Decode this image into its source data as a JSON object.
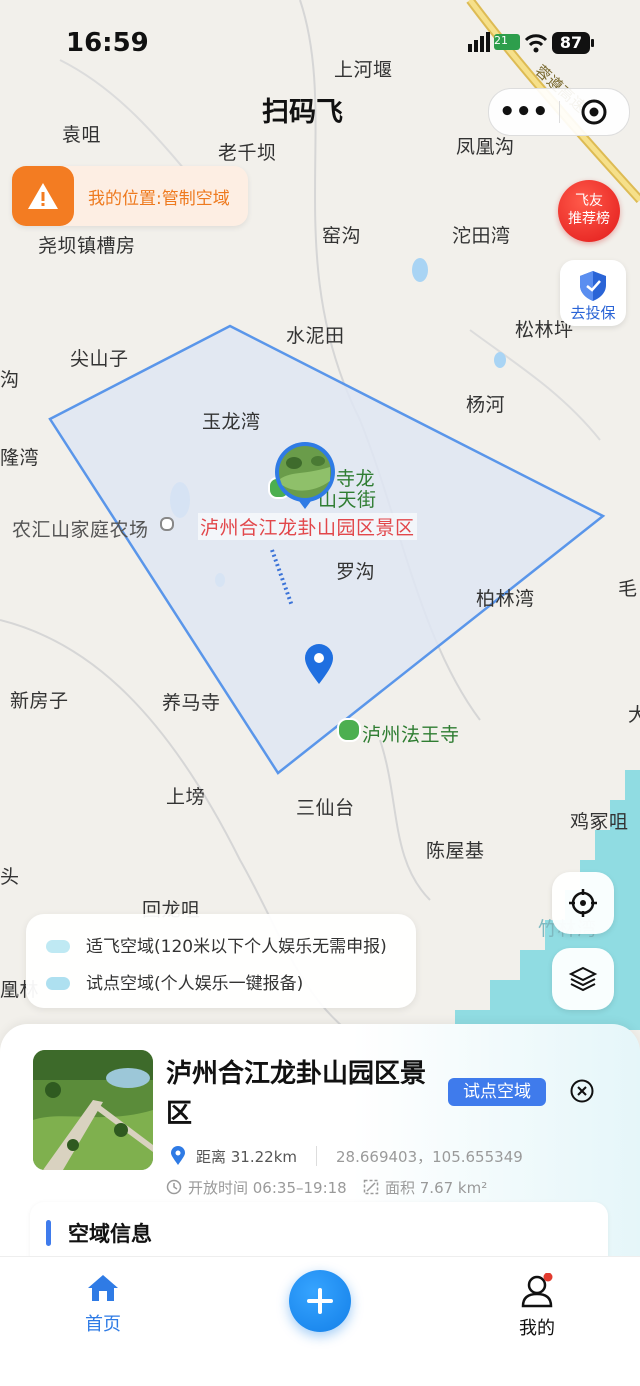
{
  "status_bar": {
    "time": "16:59",
    "battery": "87",
    "signal_tag": "21"
  },
  "header": {
    "title": "扫码飞"
  },
  "warning": {
    "text": "我的位置:管制空域"
  },
  "side_buttons": {
    "rank_line1": "飞友",
    "rank_line2": "推荐榜",
    "insure_label": "去投保"
  },
  "map": {
    "road_label": "蓉遵高速",
    "places": [
      "上河堰",
      "袁咀",
      "老千坝",
      "凤凰沟",
      "尧坝镇槽房",
      "窑沟",
      "沱田湾",
      "水泥田",
      "松林坪",
      "尖山子",
      "杨河",
      "玉龙湾",
      "隆湾",
      "寺龙",
      "山天街",
      "农汇山家庭农场",
      "泸州合江龙卦山园区景区",
      "罗沟",
      "柏林湾",
      "毛",
      "新房子",
      "养马寺",
      "泸州法王寺",
      "大",
      "上塝",
      "三仙台",
      "鸡冢咀",
      "陈屋基",
      "头",
      "回龙咀",
      "竹林湾",
      "凰林",
      "沟"
    ]
  },
  "legend": {
    "items": [
      {
        "label": "适飞空域(120米以下个人娱乐无需申报)",
        "color": "#bfe9f3"
      },
      {
        "label": "试点空域(个人娱乐一键报备)",
        "color": "#aee0f0"
      }
    ]
  },
  "detail": {
    "name": "泸州合江龙卦山园区景区",
    "badge": "试点空域",
    "distance": "距离 31.22km",
    "coords": "28.669403，105.655349",
    "open_time": "开放时间 06:35–19:18",
    "area": "面积 7.67 km²",
    "section_title": "空域信息"
  },
  "tabs": {
    "home": "首页",
    "mine": "我的"
  },
  "colors": {
    "accent": "#3f7bec",
    "warning": "#f37c22",
    "polygon_stroke": "#5a96ea",
    "polygon_fill": "#dfe6f3"
  }
}
